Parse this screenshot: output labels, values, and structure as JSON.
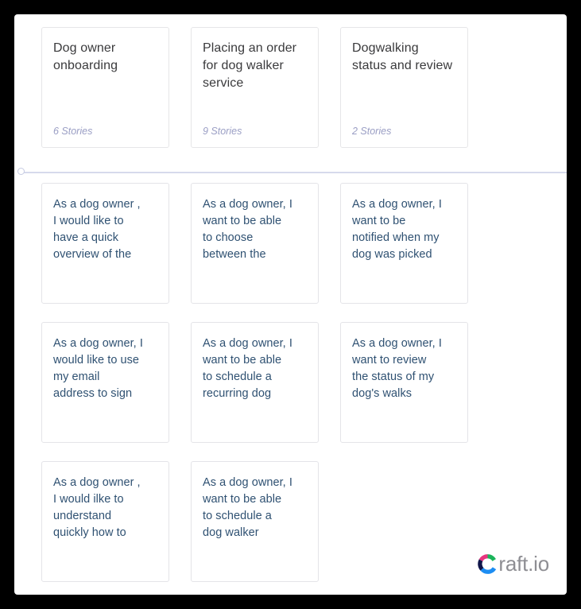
{
  "board": {
    "epics": [
      {
        "title": "Dog owner onboarding",
        "count_label": "6 Stories"
      },
      {
        "title": "Placing an order for dog walker service",
        "count_label": "9 Stories"
      },
      {
        "title": "Dogwalking status and review",
        "count_label": "2 Stories"
      }
    ],
    "divider": {
      "handle_icon": "circle-handle-icon"
    },
    "story_rows": [
      [
        {
          "text": "As a dog owner ,\nI would like to\nhave a quick\noverview of the"
        },
        {
          "text": "As a dog owner, I\nwant to be able\nto choose\nbetween the"
        },
        {
          "text": "As a dog owner, I\nwant to be\nnotified when my\ndog was picked"
        }
      ],
      [
        {
          "text": "As a dog owner, I\nwould like to use\nmy email\naddress to sign"
        },
        {
          "text": "As a dog owner, I\nwant to be able\nto schedule a\nrecurring dog"
        },
        {
          "text": "As a dog owner, I\nwant to review\nthe status of my\ndog's walks"
        }
      ],
      [
        {
          "text": "As a dog owner ,\nI would ilke to\nunderstand\nquickly how to"
        },
        {
          "text": "As a dog owner, I\nwant to be able\nto schedule a\ndog walker"
        },
        {
          "text": ""
        }
      ]
    ]
  },
  "brand": {
    "logo_icon": "craft-c-logo-icon",
    "word": "raft.io",
    "colors": {
      "mark_green": "#1bb45a",
      "mark_pink": "#e8357f",
      "mark_navy": "#10154a",
      "mark_blue": "#1d8df2",
      "word": "#8e8e93"
    }
  },
  "theme": {
    "canvas_bg": "#ffffff",
    "frame_bg": "#000000",
    "card_border": "#e5e5e9",
    "epic_title_color": "#3a3a3c",
    "epic_count_color": "#9a9ec4",
    "story_text_color": "#2f5172",
    "divider_color": "#d6daec",
    "divider_handle_color": "#c6cbe2"
  }
}
